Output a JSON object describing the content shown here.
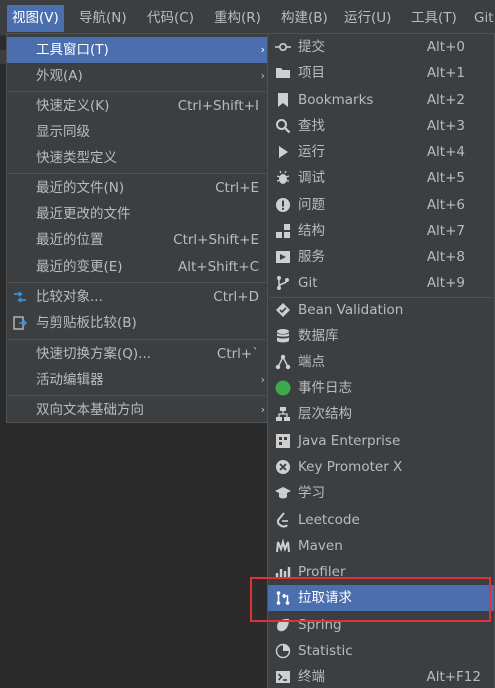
{
  "menubar": {
    "items": [
      {
        "label": "视图(V)"
      },
      {
        "label": "导航(N)"
      },
      {
        "label": "代码(C)"
      },
      {
        "label": "重构(R)"
      },
      {
        "label": "构建(B)"
      },
      {
        "label": "运行(U)"
      },
      {
        "label": "工具(T)"
      },
      {
        "label": "Git"
      }
    ]
  },
  "view_menu": {
    "items": [
      {
        "label": "工具窗口(T)",
        "arrow": "›"
      },
      {
        "label": "外观(A)",
        "arrow": "›"
      },
      {
        "label": "快速定义(K)",
        "shortcut": "Ctrl+Shift+I"
      },
      {
        "label": "显示同级"
      },
      {
        "label": "快速类型定义"
      },
      {
        "label": "最近的文件(N)",
        "shortcut": "Ctrl+E"
      },
      {
        "label": "最近更改的文件"
      },
      {
        "label": "最近的位置",
        "shortcut": "Ctrl+Shift+E"
      },
      {
        "label": "最近的变更(E)",
        "shortcut": "Alt+Shift+C"
      },
      {
        "label": "比较对象...",
        "shortcut": "Ctrl+D",
        "icon": "compare-icon"
      },
      {
        "label": "与剪贴板比较(B)",
        "icon": "clipboard-compare-icon"
      },
      {
        "label": "快速切换方案(Q)...",
        "shortcut": "Ctrl+`"
      },
      {
        "label": "活动编辑器",
        "arrow": "›"
      },
      {
        "label": "双向文本基础方向",
        "arrow": "›"
      }
    ]
  },
  "tool_windows_menu": {
    "items": [
      {
        "label": "提交",
        "shortcut": "Alt+0",
        "icon": "commit-icon"
      },
      {
        "label": "项目",
        "shortcut": "Alt+1",
        "icon": "folder-icon"
      },
      {
        "label": "Bookmarks",
        "shortcut": "Alt+2",
        "icon": "bookmark-icon"
      },
      {
        "label": "查找",
        "shortcut": "Alt+3",
        "icon": "search-icon"
      },
      {
        "label": "运行",
        "shortcut": "Alt+4",
        "icon": "run-icon"
      },
      {
        "label": "调试",
        "shortcut": "Alt+5",
        "icon": "debug-bug-icon"
      },
      {
        "label": "问题",
        "shortcut": "Alt+6",
        "icon": "problems-icon"
      },
      {
        "label": "结构",
        "shortcut": "Alt+7",
        "icon": "structure-icon"
      },
      {
        "label": "服务",
        "shortcut": "Alt+8",
        "icon": "services-icon"
      },
      {
        "label": "Git",
        "shortcut": "Alt+9",
        "icon": "git-branch-icon"
      },
      {
        "label": "Bean Validation",
        "icon": "bean-validation-icon"
      },
      {
        "label": "数据库",
        "icon": "database-icon"
      },
      {
        "label": "端点",
        "icon": "endpoints-icon"
      },
      {
        "label": "事件日志",
        "icon": "event-log-icon"
      },
      {
        "label": "层次结构",
        "icon": "hierarchy-icon"
      },
      {
        "label": "Java Enterprise",
        "icon": "java-enterprise-icon"
      },
      {
        "label": "Key Promoter X",
        "icon": "key-promoter-icon"
      },
      {
        "label": "学习",
        "icon": "learn-icon"
      },
      {
        "label": "Leetcode",
        "icon": "leetcode-icon"
      },
      {
        "label": "Maven",
        "icon": "maven-icon"
      },
      {
        "label": "Profiler",
        "icon": "profiler-icon"
      },
      {
        "label": "拉取请求",
        "icon": "pull-request-icon"
      },
      {
        "label": "Spring",
        "icon": "spring-icon"
      },
      {
        "label": "Statistic",
        "icon": "statistic-icon"
      },
      {
        "label": "终端",
        "shortcut": "Alt+F12",
        "icon": "terminal-icon"
      }
    ]
  },
  "colors": {
    "menu_bg": "#3c3f41",
    "selection": "#4b6eaf",
    "text": "#bbbbbb",
    "highlight_box": "#e0303b",
    "event_log_green": "#3ea84a",
    "compare_blue": "#3b8fd9"
  }
}
